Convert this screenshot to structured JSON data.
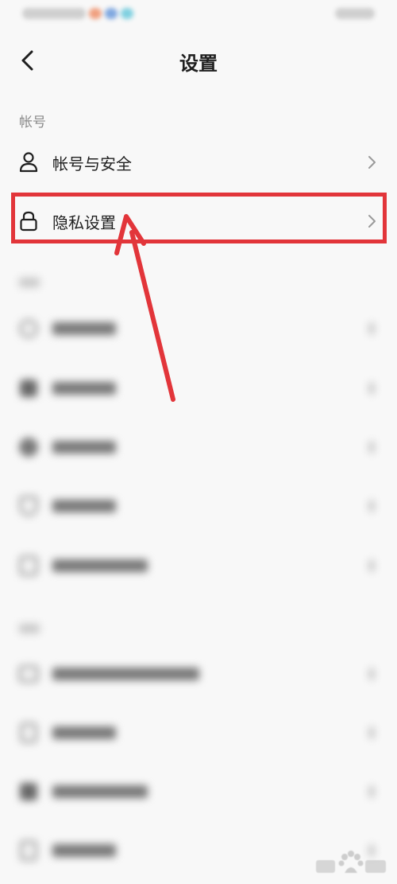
{
  "header": {
    "title": "设置"
  },
  "sections": {
    "account_label": "帐号"
  },
  "account_items": [
    {
      "label": "帐号与安全",
      "icon": "person-icon"
    },
    {
      "label": "隐私设置",
      "icon": "lock-icon"
    }
  ],
  "colors": {
    "highlight": "#e2353a",
    "text": "#1f1f1f",
    "muted": "#8a8a8a",
    "background": "#f8f8f8"
  }
}
